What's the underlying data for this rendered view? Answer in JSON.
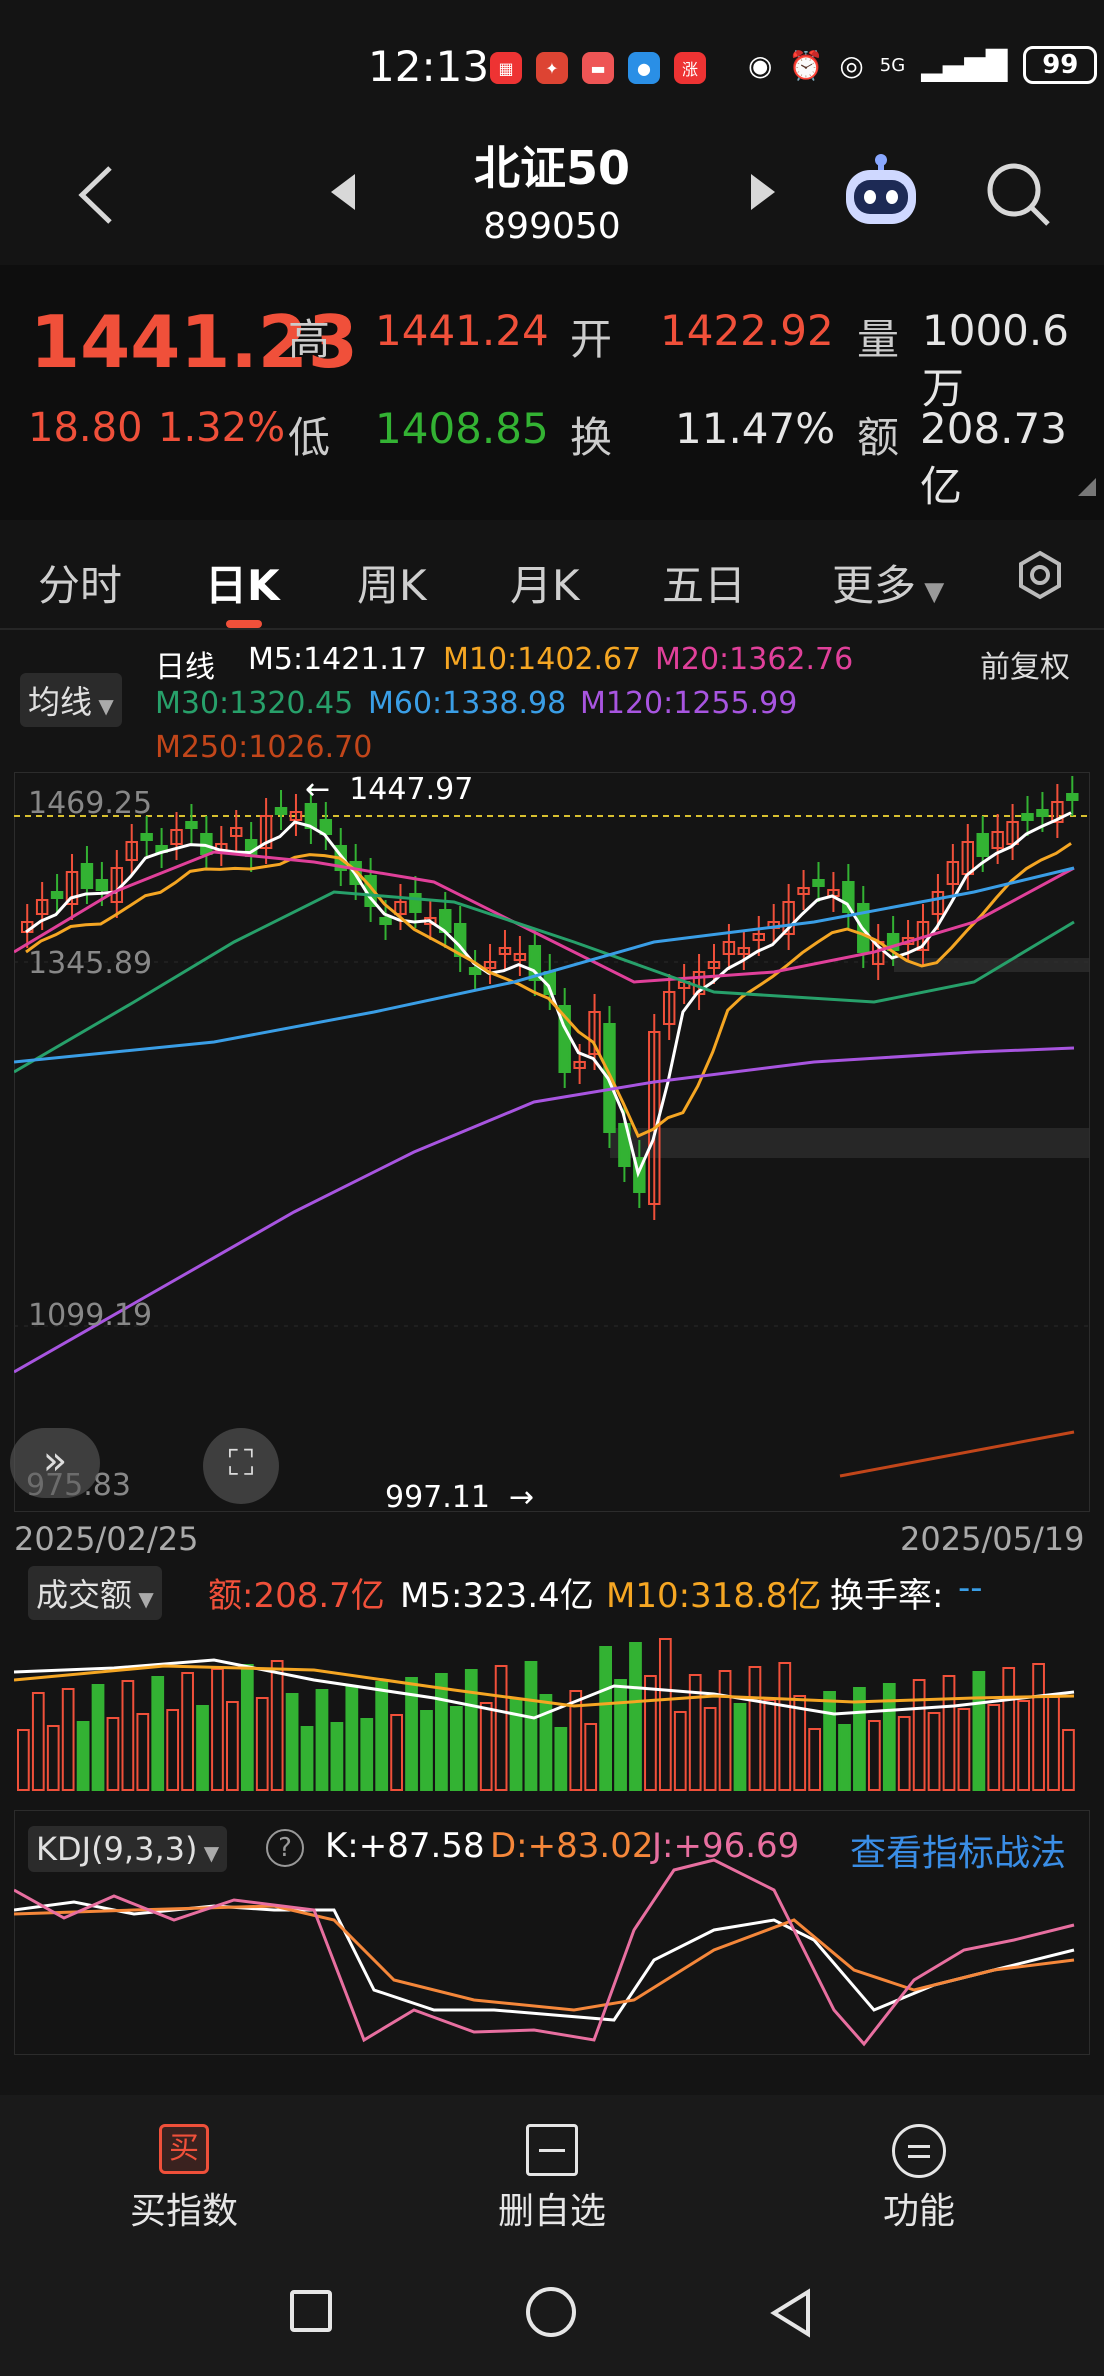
{
  "status_bar": {
    "time": "12:13",
    "network": "5G",
    "battery": "99",
    "app_icons": [
      "hongbao-icon",
      "app2-icon",
      "app3-icon",
      "chat-icon",
      "zhang-icon"
    ]
  },
  "header": {
    "title": "北证50",
    "code": "899050"
  },
  "quote": {
    "price": "1441.23",
    "change": "18.80",
    "change_pct": "1.32%",
    "high_label": "高",
    "high": "1441.24",
    "low_label": "低",
    "low": "1408.85",
    "open_label": "开",
    "open": "1422.92",
    "turnover_label": "换",
    "turnover": "11.47%",
    "volume_label": "量",
    "volume": "1000.6万",
    "amount_label": "额",
    "amount": "208.73亿"
  },
  "tabs": [
    "分时",
    "日K",
    "周K",
    "月K",
    "五日",
    "更多"
  ],
  "active_tab": "日K",
  "ma": {
    "selector": "均线",
    "title": "日线",
    "m5": "M5:1421.17",
    "m10": "M10:1402.67",
    "m20": "M20:1362.76",
    "m30": "M30:1320.45",
    "m60": "M60:1338.98",
    "m120": "M120:1255.99",
    "m250": "M250:1026.70",
    "adjust": "前复权"
  },
  "chart": {
    "y_top": "1469.25",
    "y_mid": "1345.89",
    "y_low": "1099.19",
    "y_bottom": "975.83",
    "max_label": "1447.97",
    "min_label": "997.11",
    "date_start": "2025/02/25",
    "date_end": "2025/05/19"
  },
  "volume": {
    "selector": "成交额",
    "amount": "额:208.7亿",
    "m5": "M5:323.4亿",
    "m10": "M10:318.8亿",
    "turnover": "换手率:",
    "turnover_val": "--"
  },
  "kdj": {
    "selector": "KDJ(9,3,3)",
    "k": "K:+87.58",
    "d": "D:+83.02",
    "j": "J:+96.69",
    "link": "查看指标战法"
  },
  "bottom_nav": {
    "buy_icon_text": "买",
    "buy": "买指数",
    "delete": "删自选",
    "function": "功能"
  },
  "colors": {
    "up": "#f0503a",
    "down": "#33b233",
    "m5": "#ffffff",
    "m10": "#f5a623",
    "m20": "#e0409a",
    "m30": "#27a06a",
    "m60": "#3a9ee6",
    "m120": "#a855e0",
    "m250": "#c2461a",
    "link": "#3a8ee6"
  }
}
